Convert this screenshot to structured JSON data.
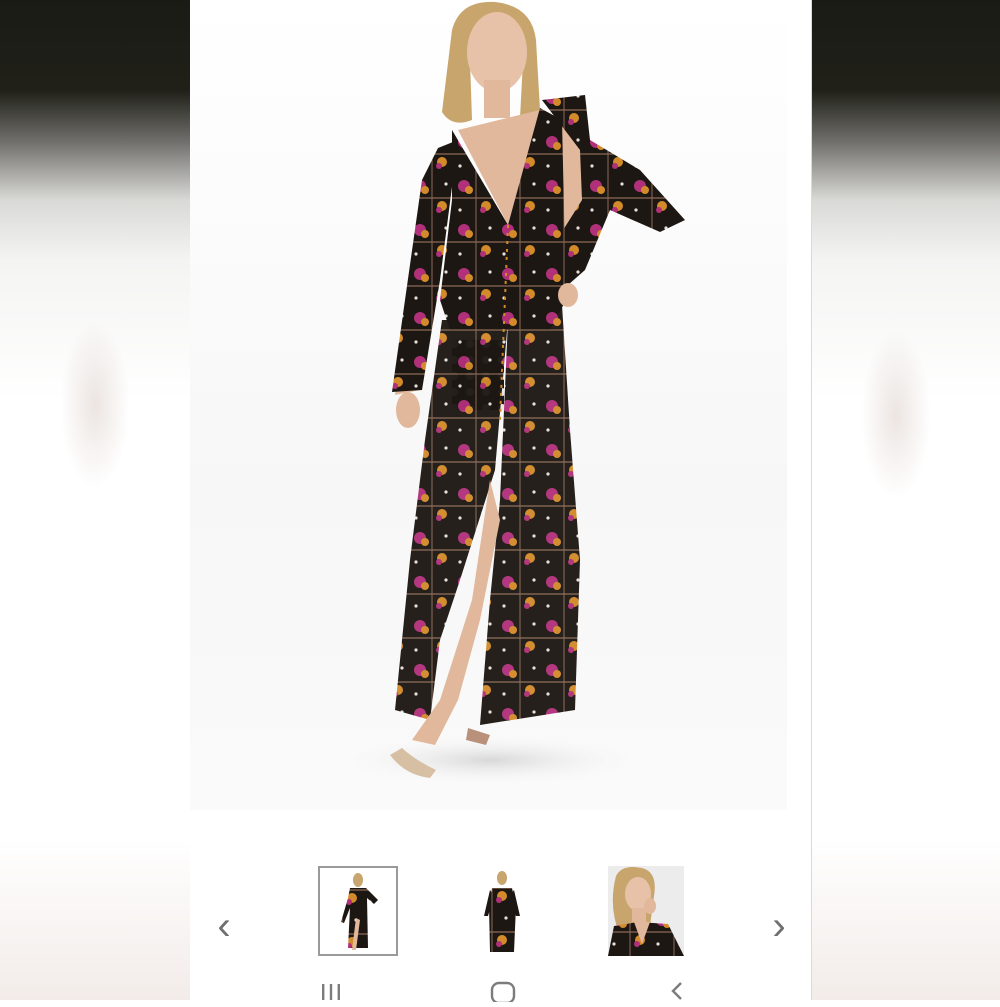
{
  "colors": {
    "dress_base": "#1d1713",
    "accent_pink": "#b0307a",
    "accent_orange": "#d38a2a",
    "arrow": "#6f6f6f",
    "thumb_border": "#9a9a9a"
  },
  "gallery": {
    "selected_index": 0,
    "thumbnails": [
      {
        "name": "front-view",
        "icon": "thumbnail-front"
      },
      {
        "name": "back-view",
        "icon": "thumbnail-back"
      },
      {
        "name": "closeup-view",
        "icon": "thumbnail-closeup"
      }
    ],
    "prev_icon": "chevron-left-icon",
    "next_icon": "chevron-right-icon"
  },
  "system_nav": {
    "recents_icon": "recents-icon",
    "home_icon": "home-icon",
    "back_icon": "back-icon"
  }
}
